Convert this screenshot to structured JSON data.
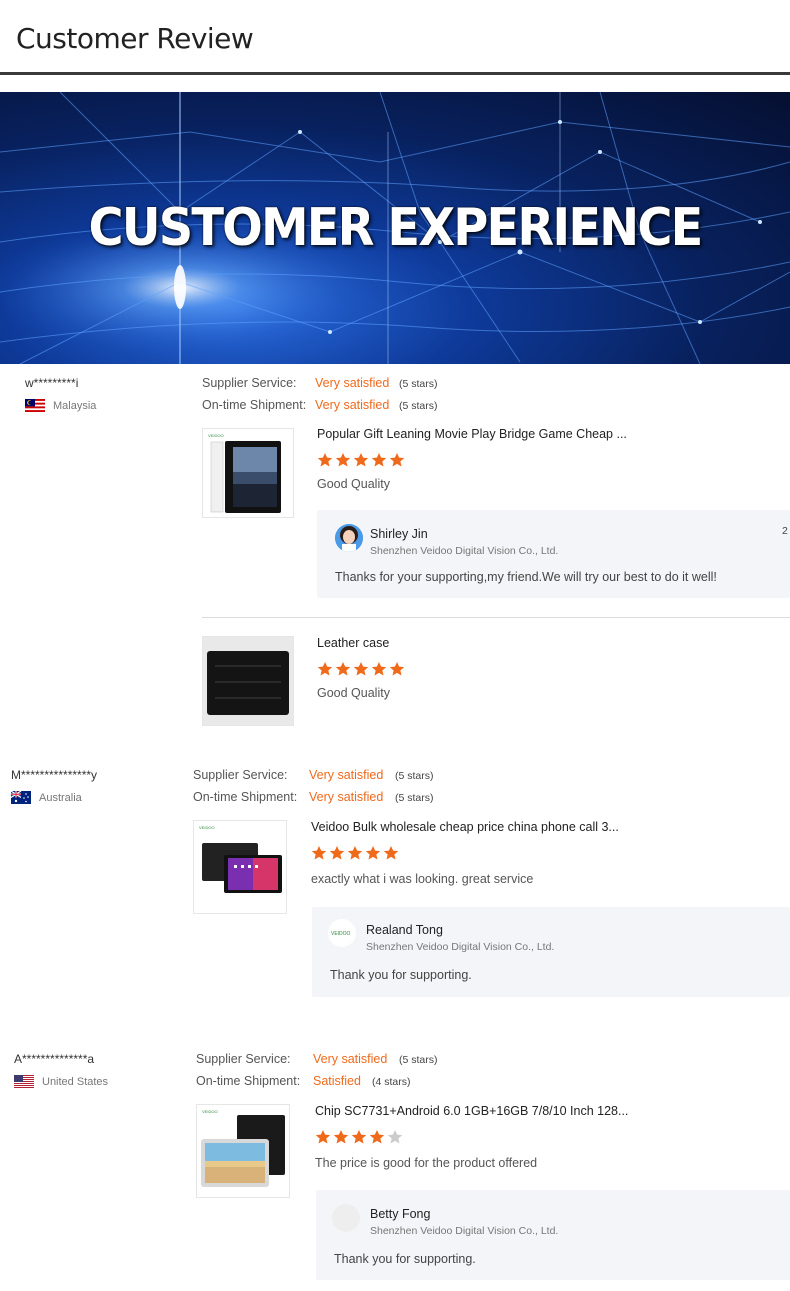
{
  "header": {
    "title": "Customer Review"
  },
  "banner": {
    "title": "CUSTOMER EXPERIENCE"
  },
  "labels": {
    "supplier_service": "Supplier Service:",
    "ontime_shipment": "On-time Shipment:"
  },
  "reviews": [
    {
      "reviewer": "w*********i",
      "country": "Malaysia",
      "supplier_rating": "Very satisfied",
      "supplier_stars_note": "(5 stars)",
      "shipment_rating": "Very satisfied",
      "shipment_stars_note": "(5 stars)",
      "products": [
        {
          "title": "Popular Gift Leaning Movie Play Bridge Game Cheap ...",
          "stars": 5,
          "comment": "Good Quality",
          "thumb_brand": "VEIDOO",
          "reply": {
            "name": "Shirley Jin",
            "company": "Shenzhen Veidoo Digital Vision Co., Ltd.",
            "text": "Thanks for your supporting,my friend.We will try our best to do it well!",
            "date_fragment": "2"
          }
        },
        {
          "title": "Leather case",
          "stars": 5,
          "comment": "Good Quality"
        }
      ]
    },
    {
      "reviewer": "M***************y",
      "country": "Australia",
      "supplier_rating": "Very satisfied",
      "supplier_stars_note": "(5 stars)",
      "shipment_rating": "Very satisfied",
      "shipment_stars_note": "(5 stars)",
      "products": [
        {
          "title": "Veidoo Bulk wholesale cheap price china phone call 3...",
          "stars": 5,
          "comment": "exactly what i was looking. great service",
          "thumb_brand": "VEIDOO",
          "reply": {
            "name": "Realand Tong",
            "company": "Shenzhen Veidoo Digital Vision Co., Ltd.",
            "text": "Thank you for supporting.",
            "avatar_text": "VEIDOO"
          }
        }
      ]
    },
    {
      "reviewer": "A**************a",
      "country": "United States",
      "supplier_rating": "Very satisfied",
      "supplier_stars_note": "(5 stars)",
      "shipment_rating": "Satisfied",
      "shipment_stars_note": "(4 stars)",
      "products": [
        {
          "title": "Chip SC7731+Android 6.0 1GB+16GB 7/8/10 Inch 128...",
          "stars": 4,
          "comment": "The price is good for the product offered",
          "thumb_brand": "VEIDOO",
          "reply": {
            "name": "Betty Fong",
            "company": "Shenzhen Veidoo Digital Vision Co., Ltd.",
            "text": "Thank you for supporting."
          }
        }
      ]
    }
  ],
  "colors": {
    "accent": "#f06a1c",
    "star_on": "#f06a1c",
    "star_off": "#cccccc",
    "reply_bg": "#f4f5f8"
  },
  "icons": {
    "star": "star-icon",
    "flag_my": "malaysia-flag-icon",
    "flag_au": "australia-flag-icon",
    "flag_us": "us-flag-icon"
  }
}
